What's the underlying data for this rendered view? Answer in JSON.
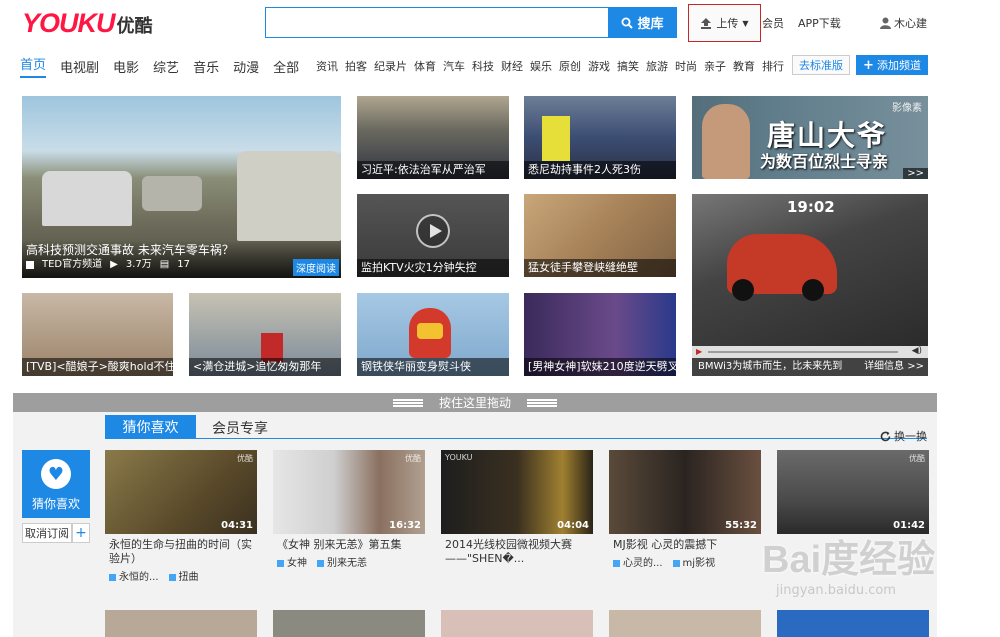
{
  "header": {
    "logo_text": "YOUKU",
    "logo_cn": "优酷",
    "search_placeholder": "",
    "search_button": "搜库",
    "upload_button": "上传",
    "vip_link": "会员",
    "app_link": "APP下载",
    "user_name": "木心建"
  },
  "nav": {
    "main": [
      "首页",
      "电视剧",
      "电影",
      "综艺",
      "音乐",
      "动漫",
      "全部"
    ],
    "sub": [
      "资讯",
      "拍客",
      "纪录片",
      "体育",
      "汽车",
      "科技",
      "财经",
      "娱乐",
      "原创",
      "游戏",
      "搞笑",
      "旅游",
      "时尚",
      "亲子",
      "教育",
      "排行"
    ],
    "std_button": "去标准版",
    "add_channel_button": "添加频道"
  },
  "featured": {
    "title": "高科技预测交通事故 未来汽车零车祸？",
    "channel": "TED官方频道",
    "views": "3.7万",
    "comments": "17",
    "badge": "深度阅读"
  },
  "tiles": [
    {
      "caption": "习近平:依法治军从严治军"
    },
    {
      "caption": "悉尼劫持事件2人死3伤"
    },
    {
      "caption": "监拍KTV火灾1分钟失控"
    },
    {
      "caption": "猛女徒手攀登峡缝绝壁"
    },
    {
      "caption": "[TVB]<醋娘子>酸爽hold不住"
    },
    {
      "caption": "<满仓进城>追忆匆匆那年"
    },
    {
      "caption": "钢铁侠华丽变身熨斗侠"
    },
    {
      "caption": "[男神女神]软妹210度逆天劈叉"
    }
  ],
  "promo": {
    "corner": "影像素",
    "line1": "唐山大爷",
    "line2": "为数百位烈士寻亲",
    "more": ">>"
  },
  "player": {
    "time": "19:02",
    "caption": "BMWi3为城市而生，比未来先到",
    "more": "详细信息 >>"
  },
  "dragbar": {
    "label": "按住这里拖动"
  },
  "recommend": {
    "tab_active": "猜你喜欢",
    "tab_other": "会员专享",
    "refresh": "换一换",
    "side_label": "猜你喜欢",
    "unsubscribe": "取消订阅",
    "plus": "+",
    "cards": [
      {
        "duration": "04:31",
        "title": "永恒的生命与扭曲的时间（实验片）",
        "tags": [
          "永恒的...",
          "扭曲"
        ]
      },
      {
        "duration": "16:32",
        "title": "《女神 别来无恙》第五集",
        "tags": [
          "女神",
          "别来无恙"
        ]
      },
      {
        "duration": "04:04",
        "title": "2014光线校园微视频大赛——\"SHEN�...",
        "tags": []
      },
      {
        "duration": "55:32",
        "title": "MJ影视 心灵的震撼下",
        "tags": [
          "心灵的...",
          "mj影视"
        ]
      },
      {
        "duration": "01:42",
        "title": "",
        "tags": []
      }
    ]
  },
  "watermark": {
    "brand": "Bai度经验",
    "url": "jingyan.baidu.com"
  }
}
